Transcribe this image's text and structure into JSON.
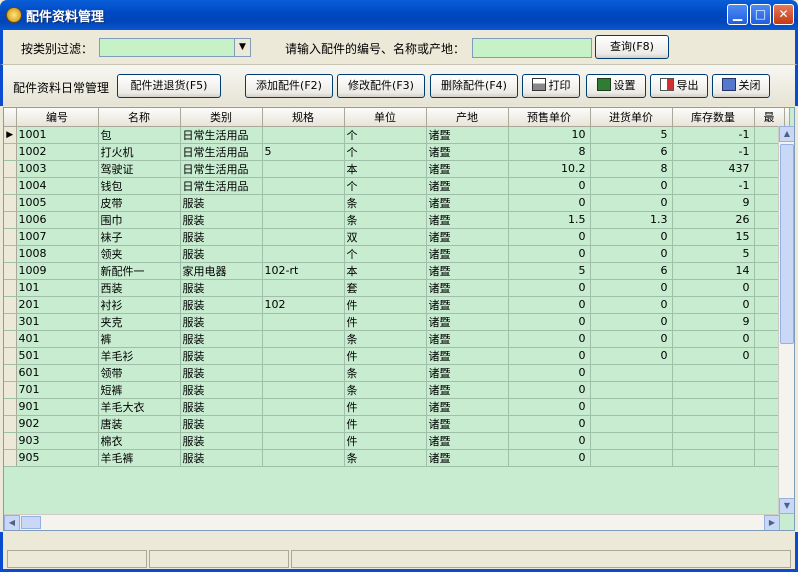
{
  "window": {
    "title": "配件资料管理"
  },
  "filter": {
    "category_label": "按类别过滤：",
    "category_value": "",
    "search_label": "请输入配件的编号、名称或产地：",
    "search_value": "",
    "query_button": "查询(F8)"
  },
  "toolbar": {
    "section_label": "配件资料日常管理",
    "stock_button": "配件进退货(F5)",
    "add_button": "添加配件(F2)",
    "edit_button": "修改配件(F3)",
    "delete_button": "删除配件(F4)",
    "print_button": "打印",
    "settings_button": "设置",
    "export_button": "导出",
    "close_button": "关闭"
  },
  "table": {
    "columns": [
      "编号",
      "名称",
      "类别",
      "规格",
      "单位",
      "产地",
      "预售单价",
      "进货单价",
      "库存数量",
      "最"
    ],
    "rows": [
      [
        "1001",
        "包",
        "日常生活用品",
        "",
        "个",
        "诸暨",
        "10",
        "5",
        "-1"
      ],
      [
        "1002",
        "打火机",
        "日常生活用品",
        "5",
        "个",
        "诸暨",
        "8",
        "6",
        "-1"
      ],
      [
        "1003",
        "驾驶证",
        "日常生活用品",
        "",
        "本",
        "诸暨",
        "10.2",
        "8",
        "437"
      ],
      [
        "1004",
        "钱包",
        "日常生活用品",
        "",
        "个",
        "诸暨",
        "0",
        "0",
        "-1"
      ],
      [
        "1005",
        "皮带",
        "服装",
        "",
        "条",
        "诸暨",
        "0",
        "0",
        "9"
      ],
      [
        "1006",
        "围巾",
        "服装",
        "",
        "条",
        "诸暨",
        "1.5",
        "1.3",
        "26"
      ],
      [
        "1007",
        "袜子",
        "服装",
        "",
        "双",
        "诸暨",
        "0",
        "0",
        "15"
      ],
      [
        "1008",
        "领夹",
        "服装",
        "",
        "个",
        "诸暨",
        "0",
        "0",
        "5"
      ],
      [
        "1009",
        "新配件一",
        "家用电器",
        "102-rt",
        "本",
        "诸暨",
        "5",
        "6",
        "14"
      ],
      [
        "101",
        "西装",
        "服装",
        "",
        "套",
        "诸暨",
        "0",
        "0",
        "0"
      ],
      [
        "201",
        "衬衫",
        "服装",
        "102",
        "件",
        "诸暨",
        "0",
        "0",
        "0"
      ],
      [
        "301",
        "夹克",
        "服装",
        "",
        "件",
        "诸暨",
        "0",
        "0",
        "9"
      ],
      [
        "401",
        "裤",
        "服装",
        "",
        "条",
        "诸暨",
        "0",
        "0",
        "0"
      ],
      [
        "501",
        "羊毛衫",
        "服装",
        "",
        "件",
        "诸暨",
        "0",
        "0",
        "0"
      ],
      [
        "601",
        "领带",
        "服装",
        "",
        "条",
        "诸暨",
        "0",
        "",
        ""
      ],
      [
        "701",
        "短裤",
        "服装",
        "",
        "条",
        "诸暨",
        "0",
        "",
        ""
      ],
      [
        "901",
        "羊毛大衣",
        "服装",
        "",
        "件",
        "诸暨",
        "0",
        "",
        ""
      ],
      [
        "902",
        "唐装",
        "服装",
        "",
        "件",
        "诸暨",
        "0",
        "",
        ""
      ],
      [
        "903",
        "棉衣",
        "服装",
        "",
        "件",
        "诸暨",
        "0",
        "",
        ""
      ],
      [
        "905",
        "羊毛裤",
        "服装",
        "",
        "条",
        "诸暨",
        "0",
        "",
        ""
      ]
    ]
  }
}
